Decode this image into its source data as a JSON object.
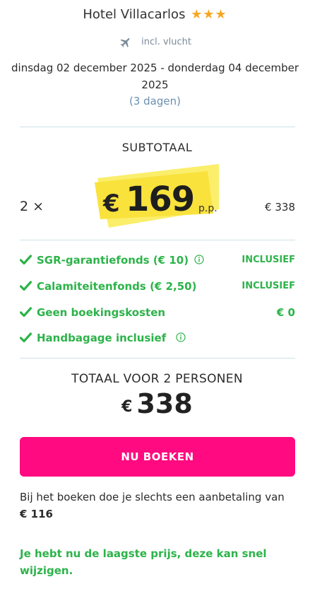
{
  "hotel": {
    "name": "Hotel Villacarlos",
    "stars": "★★★",
    "flight_label": "incl. vlucht",
    "dates": "dinsdag 02 december 2025 - donderdag 04 december 2025",
    "duration": "(3 dagen)"
  },
  "subtotal": {
    "title": "SUBTOTAAL",
    "quantity": "2 ×",
    "price_currency": "€",
    "price_per_person": "169",
    "per_person_label": "p.p.",
    "subtotal_amount": "€ 338"
  },
  "features": [
    {
      "label": "SGR-garantiefonds  (€ 10)",
      "status": "INCLUSIEF",
      "has_info": true
    },
    {
      "label": "Calamiteitenfonds  (€ 2,50)",
      "status": "INCLUSIEF",
      "has_info": false
    },
    {
      "label": "Geen boekingskosten",
      "status": "€ 0",
      "has_info": false
    },
    {
      "label": "Handbagage inclusief",
      "status": "",
      "has_info": true
    }
  ],
  "total": {
    "title": "TOTAAL VOOR 2 PERSONEN",
    "currency": "€",
    "amount": "338"
  },
  "cta": {
    "book_label": "NU BOEKEN"
  },
  "deposit": {
    "text": "Bij het boeken doe je slechts een aanbetaling van",
    "amount": "€ 116"
  },
  "urgency_message": "Je hebt nu de laagste prijs, deze kan snel wijzigen.",
  "colors": {
    "accent_pink": "#ff0a80",
    "success_green": "#2db34a",
    "star_orange": "#f5a623",
    "highlight_yellow": "#f9e84a",
    "divider": "#cfe2e6"
  }
}
